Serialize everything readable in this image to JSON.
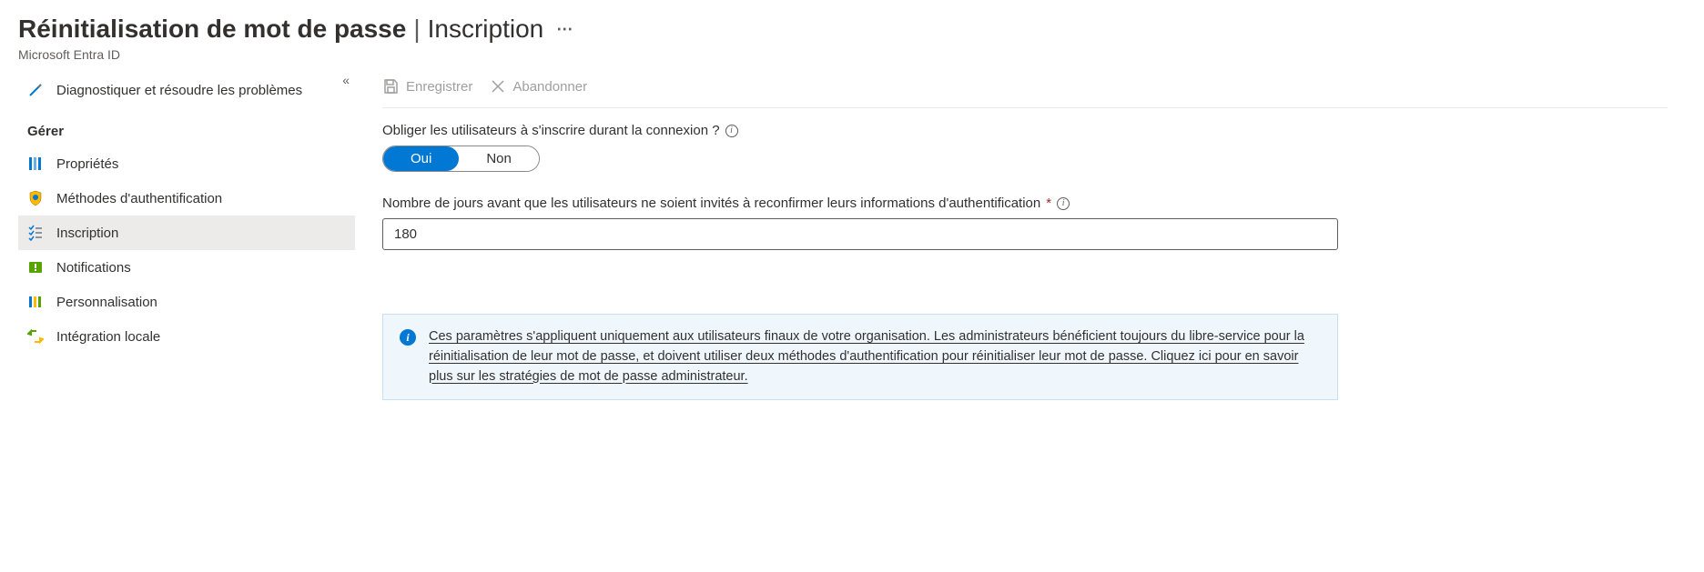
{
  "header": {
    "title_main": "Réinitialisation de mot de passe",
    "title_sub": "Inscription",
    "subtitle": "Microsoft Entra ID"
  },
  "sidebar": {
    "diagnose": {
      "label": "Diagnostiquer et résoudre les problèmes"
    },
    "section_label": "Gérer",
    "items": [
      {
        "label": "Propriétés"
      },
      {
        "label": "Méthodes d'authentification"
      },
      {
        "label": "Inscription"
      },
      {
        "label": "Notifications"
      },
      {
        "label": "Personnalisation"
      },
      {
        "label": "Intégration locale"
      }
    ]
  },
  "toolbar": {
    "save_label": "Enregistrer",
    "discard_label": "Abandonner"
  },
  "form": {
    "require_register_label": "Obliger les utilisateurs à s'inscrire durant la connexion ?",
    "toggle_yes": "Oui",
    "toggle_no": "Non",
    "days_label": "Nombre de jours avant que les utilisateurs ne soient invités à reconfirmer leurs informations d'authentification",
    "days_value": "180"
  },
  "infobox": {
    "text": "Ces paramètres s'appliquent uniquement aux utilisateurs finaux de votre organisation. Les administrateurs bénéficient toujours du libre-service pour la réinitialisation de leur mot de passe, et doivent utiliser deux méthodes d'authentification pour réinitialiser leur mot de passe. Cliquez ici pour en savoir plus sur les stratégies de mot de passe administrateur."
  }
}
